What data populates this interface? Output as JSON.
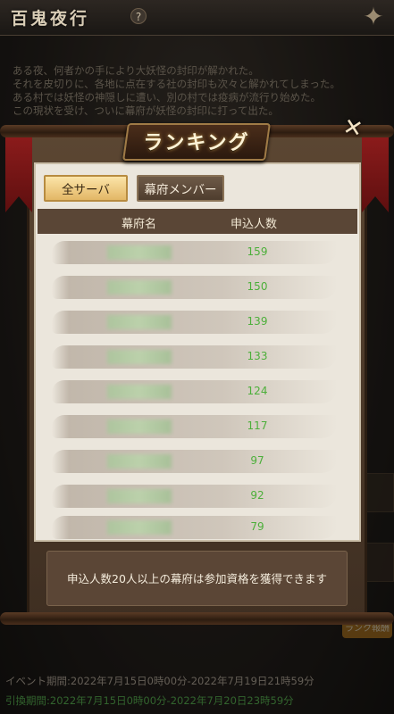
{
  "header": {
    "game_title": "百鬼夜行",
    "help_icon": "?",
    "corner_icon": "✦"
  },
  "story_lines": [
    "ある夜、何者かの手により大妖怪の封印が解かれた。",
    "それを皮切りに、各地に点在する社の封印も次々と解かれてしまった。",
    "ある村では妖怪の神隠しに遭い、別の村では疫病が流行り始めた。",
    "この現状を受け、ついに幕府が妖怪の封印に打って出た。"
  ],
  "dialog": {
    "title": "ランキング",
    "close_icon": "✕",
    "tabs": [
      {
        "label": "全サーバ",
        "selected": true
      },
      {
        "label": "幕府メンバー",
        "selected": false
      }
    ],
    "columns": {
      "name": "幕府名",
      "count": "申込人数"
    },
    "rows": [
      {
        "count": "159"
      },
      {
        "count": "150"
      },
      {
        "count": "139"
      },
      {
        "count": "133"
      },
      {
        "count": "124"
      },
      {
        "count": "117"
      },
      {
        "count": "97"
      },
      {
        "count": "92"
      },
      {
        "count": "79"
      }
    ],
    "notice": "申込人数20人以上の幕府は参加資格を獲得できます"
  },
  "side": {
    "ranking_reward_label": "ランク報酬"
  },
  "footer": {
    "event_period": "イベント期間:2022年7月15日0時00分-2022年7月19日21時59分",
    "exchange_period": "引換期間:2022年7月15日0時00分-2022年7月20日23時59分"
  },
  "colors": {
    "accent_green": "#4caf3a",
    "tab_selected": "#e3b766",
    "panel_brown": "#5a4636"
  }
}
